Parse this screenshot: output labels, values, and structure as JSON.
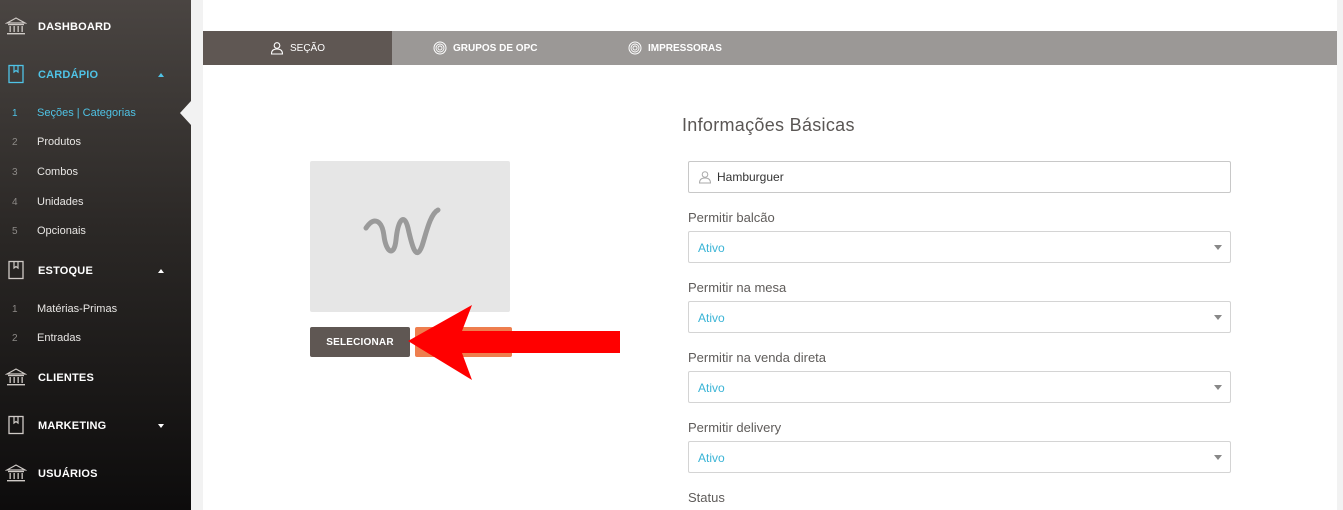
{
  "sidebar": {
    "dashboard": "DASHBOARD",
    "cardapio": "CARDÁPIO",
    "cardapio_items": [
      {
        "num": "1",
        "label": "Seções | Categorias"
      },
      {
        "num": "2",
        "label": "Produtos"
      },
      {
        "num": "3",
        "label": "Combos"
      },
      {
        "num": "4",
        "label": "Unidades"
      },
      {
        "num": "5",
        "label": "Opcionais"
      }
    ],
    "estoque": "ESTOQUE",
    "estoque_items": [
      {
        "num": "1",
        "label": "Matérias-Primas"
      },
      {
        "num": "2",
        "label": "Entradas"
      }
    ],
    "clientes": "CLIENTES",
    "marketing": "MARKETING",
    "usuarios": "USUÁRIOS"
  },
  "tabs": [
    {
      "label": "SEÇÃO",
      "icon": "user-icon"
    },
    {
      "label": "GRUPOS DE OPC",
      "icon": "fingerprint-icon"
    },
    {
      "label": "IMPRESSORAS",
      "icon": "fingerprint-icon"
    }
  ],
  "form": {
    "title": "Informações Básicas",
    "name_value": "Hamburguer",
    "fields": [
      {
        "label": "Permitir balcão",
        "value": "Ativo"
      },
      {
        "label": "Permitir na mesa",
        "value": "Ativo"
      },
      {
        "label": "Permitir na venda direta",
        "value": "Ativo"
      },
      {
        "label": "Permitir delivery",
        "value": "Ativo"
      },
      {
        "label": "Status"
      }
    ]
  },
  "image_actions": {
    "select_label": "SELECIONAR",
    "remove_label": ""
  },
  "colors": {
    "accent": "#4fc3e6",
    "tab_active": "#5f5753",
    "annotation_arrow": "#ff0000"
  }
}
